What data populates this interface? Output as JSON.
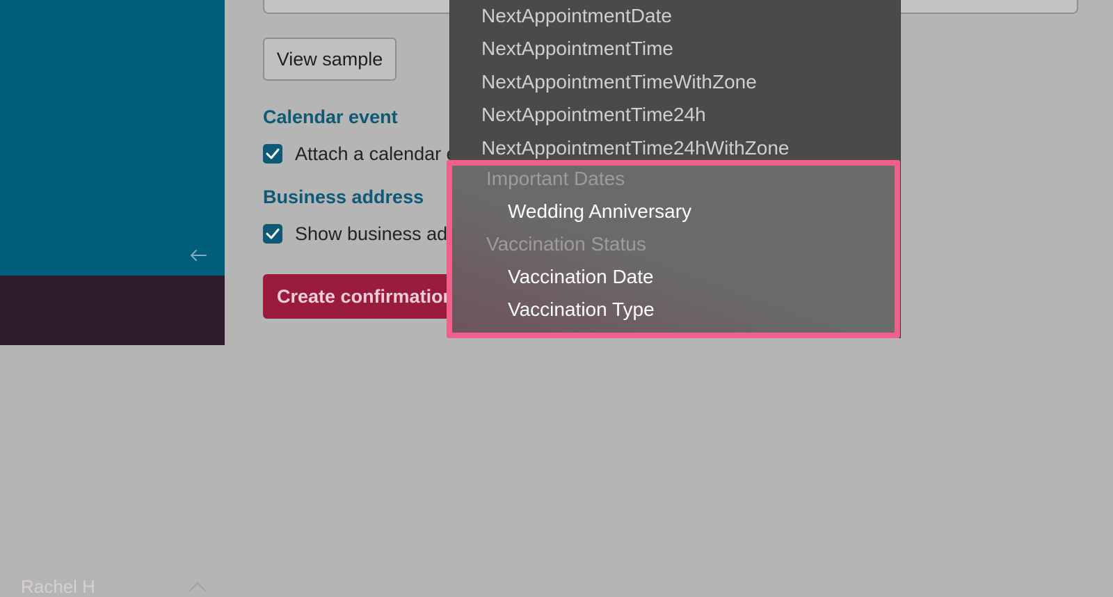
{
  "sidebar": {
    "user_name": "Rachel H"
  },
  "main": {
    "view_sample_label": "View sample",
    "calendar_event": {
      "title": "Calendar event",
      "checkbox_label": "Attach a calendar e",
      "checked": true
    },
    "business_address": {
      "title": "Business address",
      "checkbox_label": "Show business ad",
      "checked": true
    },
    "create_button_label": "Create confirmation"
  },
  "dropdown": {
    "items": [
      "NextAppointmentDate",
      "NextAppointmentTime",
      "NextAppointmentTimeWithZone",
      "NextAppointmentTime24h",
      "NextAppointmentTime24hWithZone"
    ],
    "groups": [
      {
        "header": "Important Dates",
        "items": [
          "Wedding Anniversary"
        ]
      },
      {
        "header": "Vaccination Status",
        "items": [
          "Vaccination Date",
          "Vaccination Type"
        ]
      }
    ]
  },
  "colors": {
    "sidebar": "#005e7a",
    "user_bar": "#2d1d2e",
    "accent": "#0e5a76",
    "create_button": "#9a1c3c",
    "highlight_border": "#f0608a"
  }
}
